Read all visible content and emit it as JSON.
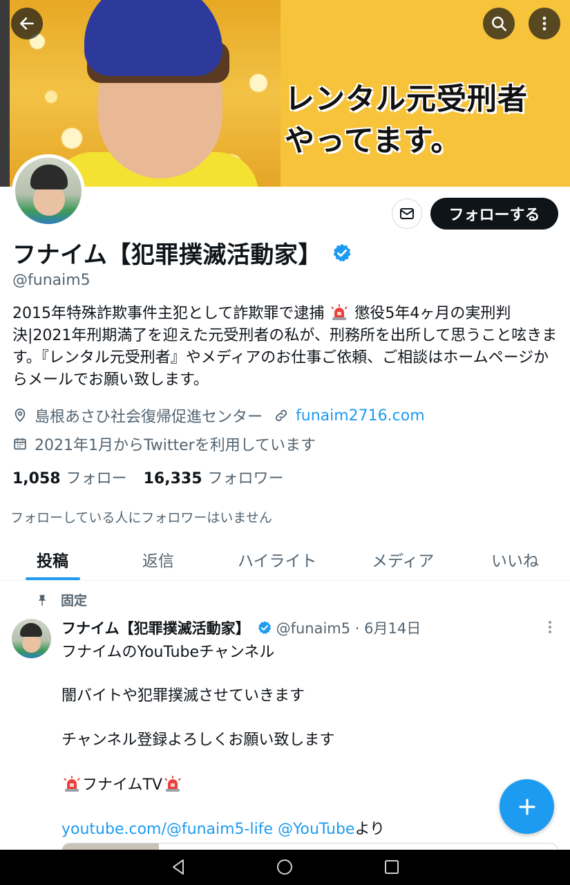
{
  "banner": {
    "text_line1": "レンタル元受刑者",
    "text_line2": "やってます。"
  },
  "header_buttons": {
    "back": "arrow-left-icon",
    "search": "search-icon",
    "more": "more-vertical-icon"
  },
  "profile": {
    "follow_label": "フォローする",
    "display_name": "フナイム【犯罪撲滅活動家】",
    "handle": "@funaim5",
    "bio_part1": "2015年特殊詐欺事件主犯として詐欺罪で逮捕",
    "bio_part2": "懲役5年4ヶ月の実刑判決|2021年刑期満了を迎えた元受刑者の私が、刑務所を出所して思うこと呟きます。『レンタル元受刑者』やメディアのお仕事ご依頼、ご相談はホームページからメールでお願い致します。",
    "location": "島根あさひ社会復帰促進センター",
    "website": "funaim2716.com",
    "joined": "2021年1月からTwitterを利用しています",
    "following_count": "1,058",
    "following_label": "フォロー",
    "followers_count": "16,335",
    "followers_label": "フォロワー",
    "no_mutual": "フォローしている人にフォロワーはいません"
  },
  "tabs": [
    {
      "label": "投稿",
      "active": true
    },
    {
      "label": "返信",
      "active": false
    },
    {
      "label": "ハイライト",
      "active": false
    },
    {
      "label": "メディア",
      "active": false
    },
    {
      "label": "いいね",
      "active": false
    }
  ],
  "pinned_tweet": {
    "pinned_label": "固定",
    "author_name": "フナイム【犯罪撲滅活動家】",
    "author_meta": "@funaim5 · 6月14日",
    "line1": "フナイムのYouTubeチャンネル",
    "line2": "闇バイトや犯罪撲滅させていきます",
    "line3": "チャンネル登録よろしくお願い致します",
    "line4": "フナイムTV",
    "link_text": "youtube.com/@funaim5-life",
    "mention_text": "@YouTube",
    "suffix": "より"
  },
  "colors": {
    "accent": "#1d9bf0",
    "text_primary": "#0f1419",
    "text_secondary": "#536471",
    "banner_yellow": "#f6c33a"
  }
}
